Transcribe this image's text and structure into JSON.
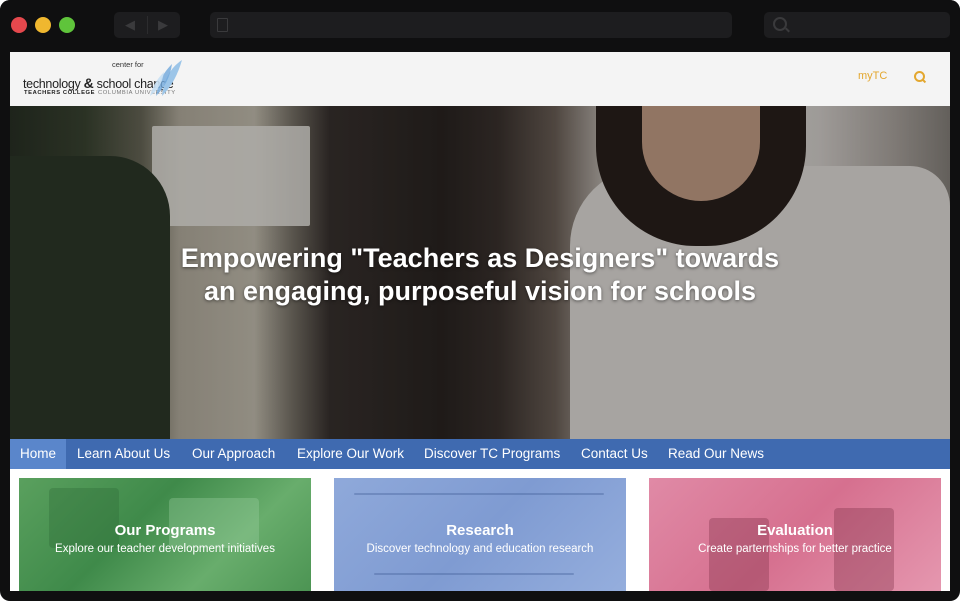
{
  "site": {
    "logo": {
      "line1": "center for",
      "line2a": "technology",
      "amp": "&",
      "line2b": "school change",
      "line3a": "TEACHERS COLLEGE",
      "line3b": "COLUMBIA UNIVERSITY"
    },
    "header_link": "myTC"
  },
  "hero": {
    "line1": "Empowering \"Teachers as Designers\" towards",
    "line2": "an engaging, purposeful vision for schools"
  },
  "nav": {
    "items": [
      "Home",
      "Learn About Us",
      "Our Approach",
      "Explore Our Work",
      "Discover TC Programs",
      "Contact Us",
      "Read Our News"
    ]
  },
  "cards": [
    {
      "title": "Our Programs",
      "subtitle": "Explore our teacher development initiatives"
    },
    {
      "title": "Research",
      "subtitle": "Discover technology and education research"
    },
    {
      "title": "Evaluation",
      "subtitle": "Create parternships for better practice"
    }
  ],
  "colors": {
    "nav_bg": "#3f6ab0",
    "nav_active": "#5a86cb",
    "accent": "#e3a72f",
    "card_green": "#4c9453",
    "card_blue": "#8fa9da",
    "card_pink": "#d6708f"
  },
  "icons": [
    "close-window-icon",
    "minimize-window-icon",
    "zoom-window-icon",
    "back-arrow-icon",
    "forward-arrow-icon",
    "page-icon",
    "search-icon"
  ]
}
